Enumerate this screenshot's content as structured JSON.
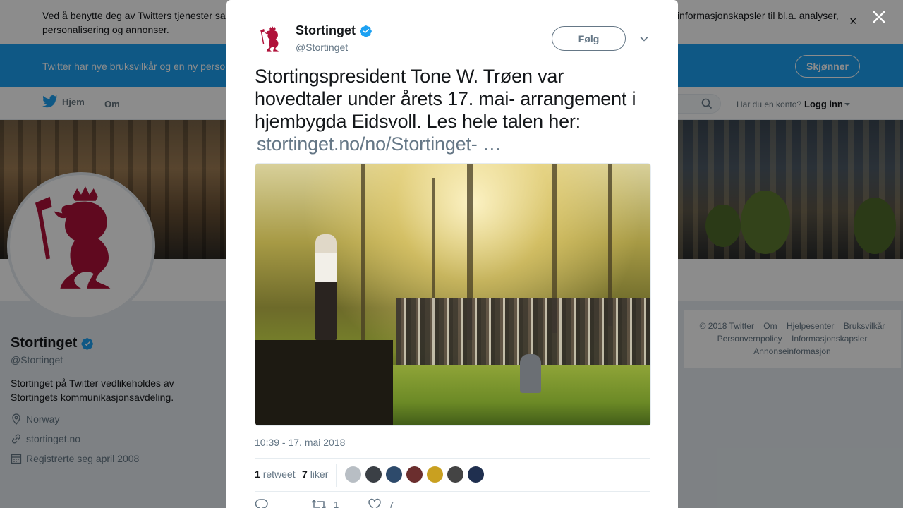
{
  "cookie": {
    "text_left": "Ved å benytte deg av Twitters tjenester sa personalisering og annonser.",
    "text_right": "informasjonskapsler til bl.a. analyser,"
  },
  "terms": {
    "text": "Twitter har nye bruksvilkår og en ny person",
    "button": "Skjønner"
  },
  "nav": {
    "home": "Hjem",
    "about": "Om",
    "login_question": "Har du en konto?",
    "login": "Logg inn"
  },
  "profile": {
    "name": "Stortinget",
    "handle": "@Stortinget",
    "bio": "Stortinget på Twitter vedlikeholdes av Stortingets kommunikasjonsavdeling.",
    "location": "Norway",
    "website": "stortinget.no",
    "joined": "Registrerte seg april 2008"
  },
  "footer": {
    "links": [
      "© 2018 Twitter",
      "Om",
      "Hjelpesenter",
      "Bruksvilkår",
      "Personvernpolicy",
      "Informasjonskapsler",
      "Annonseinformasjon"
    ]
  },
  "tweet": {
    "author_name": "Stortinget",
    "author_handle": "@Stortinget",
    "follow_label": "Følg",
    "text": "Stortingspresident Tone W. Trøen var hovedtaler under årets 17. mai- arrangement i hjembygda Eidsvoll. Les hele talen her:",
    "link": "stortinget.no/no/Stortinget-    …",
    "timestamp": "10:39 - 17. mai 2018",
    "retweets_count": "1",
    "retweets_label": "retweet",
    "likes_count": "7",
    "likes_label": "liker",
    "reply_count": "",
    "retweet_action_count": "1",
    "like_action_count": "7"
  },
  "colors": {
    "brand_blue": "#1da1f2",
    "stortinget_red": "#b0123a",
    "verified_blue": "#1da1f2"
  },
  "likers": [
    "#b8bec4",
    "#3a3f45",
    "#2d4a6b",
    "#6b2e2e",
    "#c9a020",
    "#444444",
    "#1f2f4f"
  ]
}
